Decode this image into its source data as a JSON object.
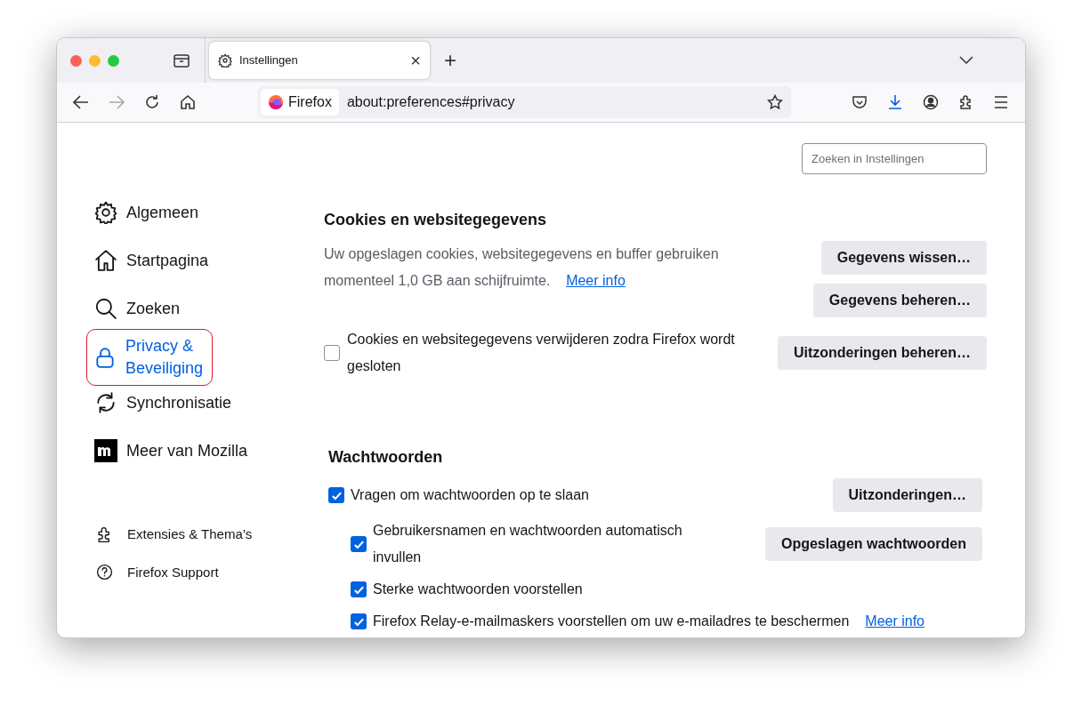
{
  "tabs": [
    {
      "label": "Instellingen",
      "selected": true,
      "close": "×"
    }
  ],
  "new_tab": "+",
  "url_bar": {
    "identity": "Firefox",
    "url": "about:preferences#privacy"
  },
  "search": {
    "placeholder": "Zoeken in Instellingen"
  },
  "sidebar": {
    "items": [
      {
        "kind": "gear",
        "label": "Algemeen",
        "selected": false
      },
      {
        "kind": "home",
        "label": "Startpagina",
        "selected": false
      },
      {
        "kind": "search",
        "label": "Zoeken",
        "selected": false
      },
      {
        "kind": "lock",
        "label": "Privacy & Beveiliging",
        "selected": true
      },
      {
        "kind": "sync",
        "label": "Synchronisatie",
        "selected": false
      },
      {
        "kind": "mozilla",
        "label": "Meer van Mozilla",
        "selected": false
      }
    ],
    "footer": [
      {
        "kind": "puzzle",
        "label": "Extensies & Thema’s"
      },
      {
        "kind": "help",
        "label": "Firefox Support"
      }
    ]
  },
  "cookies": {
    "title": "Cookies en websitegegevens",
    "description": "Uw opgeslagen cookies, websitegegevens en buffer gebruiken momenteel 1,0 GB aan schijfruimte.",
    "link": "Meer info",
    "buttons": [
      "Gegevens wissen…",
      "Gegevens beheren…"
    ],
    "option": {
      "label": "Cookies en websitegegevens verwijderen zodra Firefox wordt gesloten",
      "checked": false,
      "button": "Uitzonderingen beheren…"
    }
  },
  "passwords": {
    "title": "Wachtwoorden",
    "items": [
      {
        "label": "Vragen om wachtwoorden op te slaan",
        "checked": true,
        "button": "Uitzonderingen…",
        "children": [
          {
            "label": "Gebruikersnamen en wachtwoorden automatisch invullen",
            "checked": true,
            "button": "Opgeslagen wachtwoorden"
          },
          {
            "label": "Sterke wachtwoorden voorstellen",
            "checked": true
          },
          {
            "label": "Firefox Relay-e-mailmaskers voorstellen om uw e-mailadres te beschermen",
            "checked": true,
            "link": "Meer info"
          }
        ]
      }
    ]
  }
}
